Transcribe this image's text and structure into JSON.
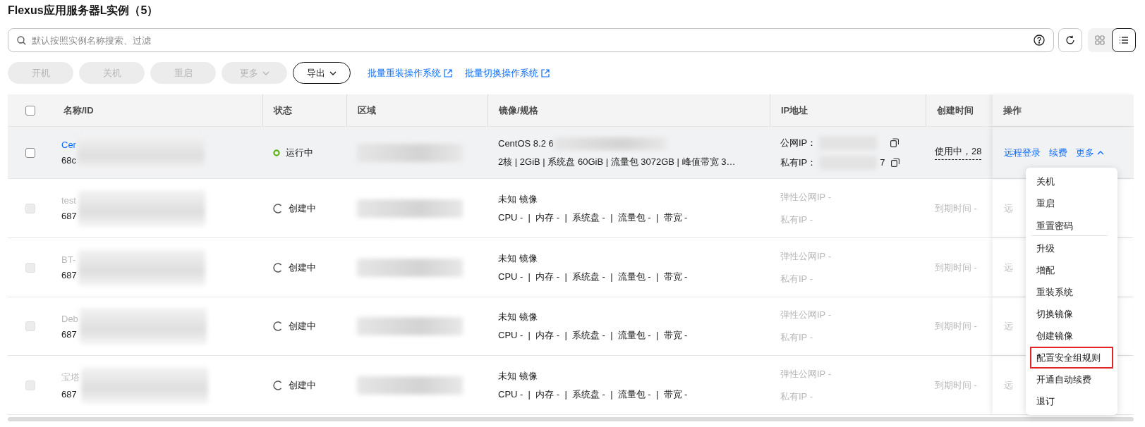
{
  "title": "Flexus应用服务器L实例（5）",
  "search": {
    "placeholder": "默认按照实例名称搜索、过滤"
  },
  "views": [
    {
      "kind": "grid",
      "selected": false
    },
    {
      "kind": "list",
      "selected": true
    }
  ],
  "toolbar": [
    {
      "label": "开机",
      "disabled": true,
      "caret": false
    },
    {
      "label": "关机",
      "disabled": true,
      "caret": false
    },
    {
      "label": "重启",
      "disabled": true,
      "caret": false
    },
    {
      "label": "更多",
      "disabled": true,
      "caret": true
    },
    {
      "label": "导出",
      "disabled": false,
      "caret": true
    }
  ],
  "links": [
    "批量重装操作系统",
    "批量切换操作系统"
  ],
  "table": {
    "header_checked": false,
    "columns": [
      "名称/ID",
      "状态",
      "区域",
      "镜像/规格",
      "IP地址",
      "创建时间",
      "操作"
    ],
    "rows": [
      {
        "highlighted": true,
        "disabled": false,
        "checked": false,
        "name": "Cer",
        "id": "68c",
        "status": {
          "kind": "running",
          "label": "运行中"
        },
        "image": {
          "name": "CentOS 8.2 6",
          "masked": true,
          "spec": "2核 | 2GiB | 系统盘 60GiB | 流量包 3072GB | 峰值带宽 3…"
        },
        "ip": [
          {
            "kind": "masked",
            "label": "公网IP："
          },
          {
            "kind": "masked",
            "label": "私有IP：",
            "suffix": "7"
          }
        ],
        "created": {
          "kind": "active",
          "text": "使用中，28"
        },
        "actions": [
          "远程登录",
          "续费"
        ],
        "more": {
          "label": "更多",
          "expanded": true
        }
      },
      {
        "highlighted": false,
        "disabled": true,
        "checked": false,
        "name": "test",
        "id": "687",
        "status": {
          "kind": "creating",
          "label": "创建中"
        },
        "image": {
          "name": "未知 镜像",
          "masked": false,
          "spec": "CPU -  |  内存 -  |  系统盘 -  |  流量包 -  |  带宽 -"
        },
        "ip": [
          {
            "kind": "empty",
            "label": "弹性公网IP -"
          },
          {
            "kind": "empty",
            "label": "私有IP -"
          }
        ],
        "created": {
          "kind": "empty",
          "text": "到期时间 -"
        },
        "actions": [
          "远"
        ]
      },
      {
        "highlighted": false,
        "disabled": true,
        "checked": false,
        "name": "BT-",
        "id": "687",
        "status": {
          "kind": "creating",
          "label": "创建中"
        },
        "image": {
          "name": "未知 镜像",
          "masked": false,
          "spec": "CPU -  |  内存 -  |  系统盘 -  |  流量包 -  |  带宽 -"
        },
        "ip": [
          {
            "kind": "empty",
            "label": "弹性公网IP -"
          },
          {
            "kind": "empty",
            "label": "私有IP -"
          }
        ],
        "created": {
          "kind": "empty",
          "text": "到期时间 -"
        },
        "actions": [
          "远"
        ]
      },
      {
        "highlighted": false,
        "disabled": true,
        "checked": false,
        "name": "Deb",
        "id": "687",
        "status": {
          "kind": "creating",
          "label": "创建中"
        },
        "image": {
          "name": "未知 镜像",
          "masked": false,
          "spec": "CPU -  |  内存 -  |  系统盘 -  |  流量包 -  |  带宽 -"
        },
        "ip": [
          {
            "kind": "empty",
            "label": "弹性公网IP -"
          },
          {
            "kind": "empty",
            "label": "私有IP -"
          }
        ],
        "created": {
          "kind": "empty",
          "text": "到期时间 -"
        },
        "actions": [
          "远"
        ]
      },
      {
        "highlighted": false,
        "disabled": true,
        "checked": false,
        "name": "宝塔",
        "id": "687",
        "status": {
          "kind": "creating",
          "label": "创建中"
        },
        "image": {
          "name": "未知 镜像",
          "masked": false,
          "spec": "CPU -  |  内存 -  |  系统盘 -  |  流量包 -  |  带宽 -"
        },
        "ip": [
          {
            "kind": "empty",
            "label": "弹性公网IP -"
          },
          {
            "kind": "empty",
            "label": "私有IP -"
          }
        ],
        "created": {
          "kind": "empty",
          "text": "到期时间 -"
        },
        "actions": [
          "远"
        ]
      }
    ]
  },
  "menu": [
    {
      "label": "关机",
      "outlined": false,
      "divider_after": false
    },
    {
      "label": "重启",
      "outlined": false,
      "divider_after": false
    },
    {
      "label": "重置密码",
      "outlined": false,
      "divider_after": true
    },
    {
      "label": "升级",
      "outlined": false,
      "divider_after": false
    },
    {
      "label": "增配",
      "outlined": false,
      "divider_after": false
    },
    {
      "label": "重装系统",
      "outlined": false,
      "divider_after": false
    },
    {
      "label": "切换镜像",
      "outlined": false,
      "divider_after": false
    },
    {
      "label": "创建镜像",
      "outlined": false,
      "divider_after": false
    },
    {
      "label": "配置安全组规则",
      "outlined": true,
      "divider_after": false
    },
    {
      "label": "开通自动续费",
      "outlined": false,
      "divider_after": false
    },
    {
      "label": "退订",
      "outlined": false,
      "divider_after": false
    }
  ]
}
